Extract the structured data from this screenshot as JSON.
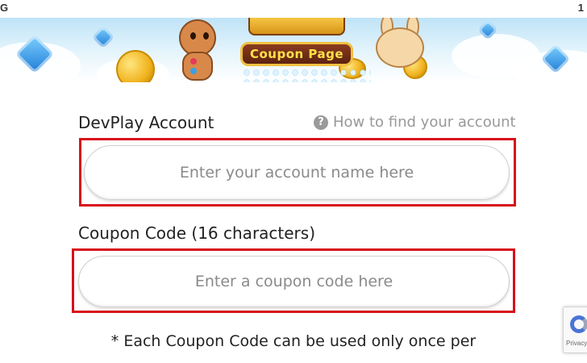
{
  "status_bar": {
    "left_text": "G",
    "right_text": "1"
  },
  "banner": {
    "logo_text": "Coupon Page"
  },
  "account": {
    "label": "DevPlay Account",
    "help_link": "How to find your account",
    "help_icon": "question-circle-icon",
    "placeholder": "Enter your account name here",
    "value": ""
  },
  "coupon": {
    "label": "Coupon Code (16 characters)",
    "placeholder": "Enter a coupon code here",
    "value": ""
  },
  "note": "* Each Coupon Code can be used only once per",
  "recaptcha": {
    "label": "Privacy"
  },
  "colors": {
    "highlight": "#d8101c",
    "text": "#222222",
    "muted": "#999999"
  }
}
